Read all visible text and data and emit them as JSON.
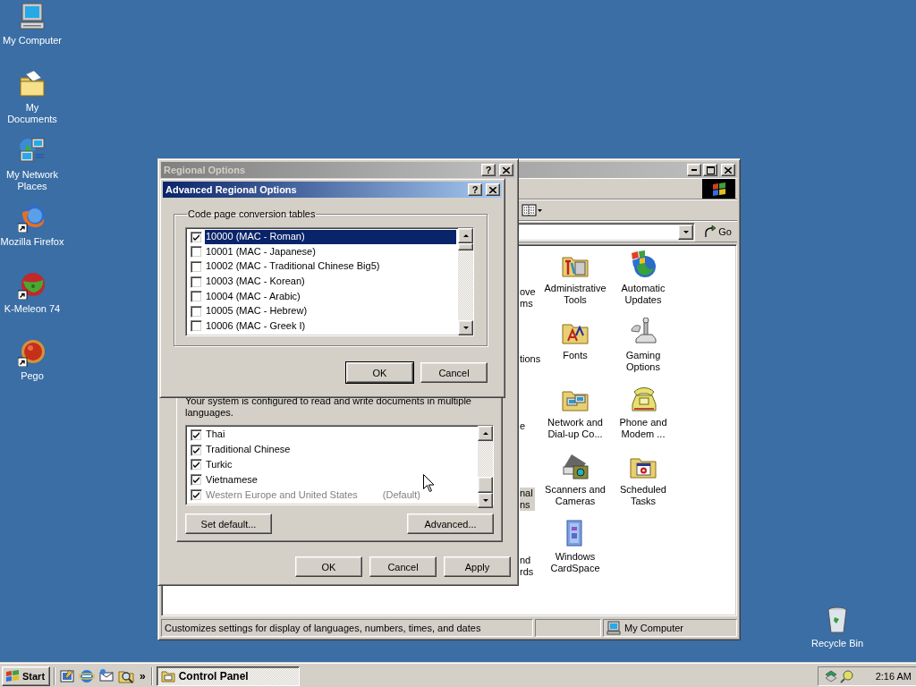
{
  "desktop_icons": [
    {
      "label": "My Computer",
      "kind": "computer",
      "shortcut": false
    },
    {
      "label": "My Documents",
      "kind": "documents",
      "shortcut": false
    },
    {
      "label": "My Network Places",
      "kind": "network",
      "shortcut": false
    },
    {
      "label": "Mozilla Firefox",
      "kind": "firefox",
      "shortcut": true
    },
    {
      "label": "K-Meleon 74",
      "kind": "kmeleon",
      "shortcut": true
    },
    {
      "label": "Pego",
      "kind": "pego",
      "shortcut": true
    }
  ],
  "recycle_bin": {
    "label": "Recycle Bin"
  },
  "control_panel": {
    "active": false,
    "go_button": "Go",
    "partial_items": [
      {
        "label": "ove ms",
        "selected": false
      },
      {
        "label": "tions",
        "selected": false
      },
      {
        "label": "e",
        "selected": false
      },
      {
        "label": "nal ns",
        "selected": true
      },
      {
        "label": "nd rds",
        "selected": false
      }
    ],
    "items": [
      {
        "label": "Administrative Tools",
        "kind": "tools"
      },
      {
        "label": "Automatic Updates",
        "kind": "update"
      },
      {
        "label": "Fonts",
        "kind": "fonts"
      },
      {
        "label": "Gaming Options",
        "kind": "gaming"
      },
      {
        "label": "Network and Dial-up Co...",
        "kind": "network"
      },
      {
        "label": "Phone and Modem ...",
        "kind": "phone"
      },
      {
        "label": "Scanners and Cameras",
        "kind": "scanner"
      },
      {
        "label": "Scheduled Tasks",
        "kind": "scheduled"
      },
      {
        "label": "Windows CardSpace",
        "kind": "cardspace"
      }
    ],
    "status_bar": {
      "text": "Customizes settings for display of languages, numbers, times, and dates",
      "zone": "My Computer"
    }
  },
  "regional_options": {
    "title": "Regional Options",
    "help_button": "?",
    "active": false,
    "description": "Your system is configured to read and write documents in multiple languages.",
    "languages": [
      {
        "label": "Thai",
        "checked": true,
        "disabled": false
      },
      {
        "label": "Traditional Chinese",
        "checked": true,
        "disabled": false
      },
      {
        "label": "Turkic",
        "checked": true,
        "disabled": false
      },
      {
        "label": "Vietnamese",
        "checked": true,
        "disabled": false
      },
      {
        "label": "Western Europe and United States",
        "note": "(Default)",
        "checked": true,
        "disabled": true
      }
    ],
    "group_buttons": [
      "Set default...",
      "Advanced..."
    ],
    "buttons": [
      "OK",
      "Cancel",
      "Apply"
    ]
  },
  "advanced_options": {
    "title": "Advanced Regional Options",
    "help_button": "?",
    "active": true,
    "group_label": "Code page conversion tables",
    "code_pages": [
      {
        "label": "10000 (MAC - Roman)",
        "checked": true,
        "selected": true
      },
      {
        "label": "10001 (MAC - Japanese)",
        "checked": false,
        "selected": false
      },
      {
        "label": "10002 (MAC - Traditional Chinese Big5)",
        "checked": false,
        "selected": false
      },
      {
        "label": "10003 (MAC - Korean)",
        "checked": false,
        "selected": false
      },
      {
        "label": "10004 (MAC - Arabic)",
        "checked": false,
        "selected": false
      },
      {
        "label": "10005 (MAC - Hebrew)",
        "checked": false,
        "selected": false
      },
      {
        "label": "10006 (MAC - Greek I)",
        "checked": false,
        "selected": false
      }
    ],
    "buttons": [
      "OK",
      "Cancel"
    ]
  },
  "taskbar": {
    "start": "Start",
    "chevron": "»",
    "tasks": [
      {
        "label": "Control Panel",
        "selected": true
      }
    ],
    "clock": "2:16 AM"
  }
}
